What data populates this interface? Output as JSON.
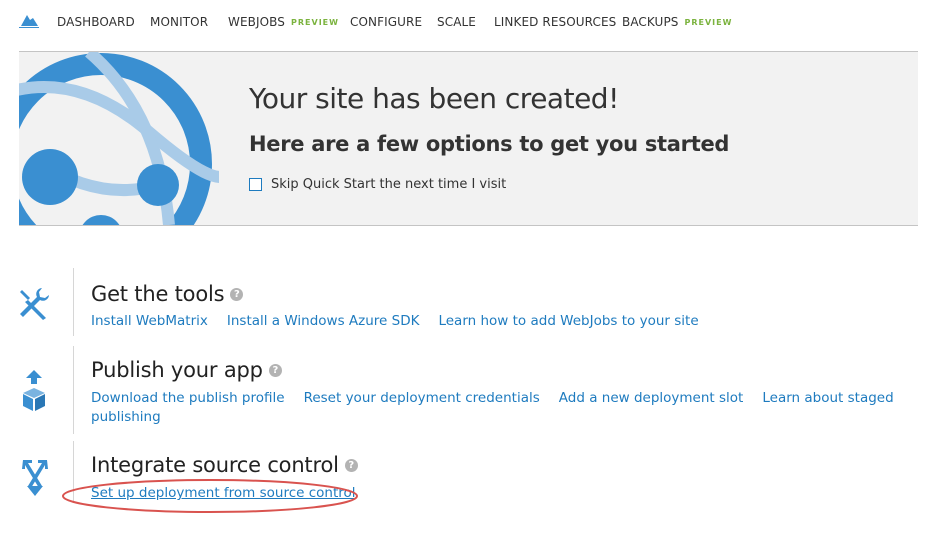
{
  "nav": {
    "items": [
      {
        "label": "DASHBOARD"
      },
      {
        "label": "MONITOR"
      },
      {
        "label": "WEBJOBS",
        "badge": "PREVIEW"
      },
      {
        "label": "CONFIGURE"
      },
      {
        "label": "SCALE"
      },
      {
        "label": "LINKED RESOURCES"
      },
      {
        "label": "BACKUPS",
        "badge": "PREVIEW"
      }
    ],
    "logo_icon": "azure-cloud-icon"
  },
  "banner": {
    "title": "Your site has been created!",
    "subtitle": "Here are a few options to get you started",
    "skip_label": "Skip Quick Start the next time I visit",
    "skip_checked": false,
    "art_icon": "globe-network-icon"
  },
  "sections": [
    {
      "title": "Get the tools",
      "icon": "wrench-screwdriver-icon",
      "help": "?",
      "links": [
        "Install WebMatrix",
        "Install a Windows Azure SDK",
        "Learn how to add WebJobs to your site"
      ]
    },
    {
      "title": "Publish your app",
      "icon": "upload-box-icon",
      "help": "?",
      "links": [
        "Download the publish profile",
        "Reset your deployment credentials",
        "Add a new deployment slot",
        "Learn about staged",
        "publishing"
      ]
    },
    {
      "title": "Integrate source control",
      "icon": "merge-arrows-icon",
      "help": "?",
      "links": [
        "Set up deployment from source control"
      ]
    }
  ],
  "colors": {
    "link": "#1e7bbf",
    "badge": "#7bb33e",
    "icon_blue": "#3a8fd1",
    "banner_bg": "#f2f2f2",
    "highlight": "#d9534f"
  }
}
